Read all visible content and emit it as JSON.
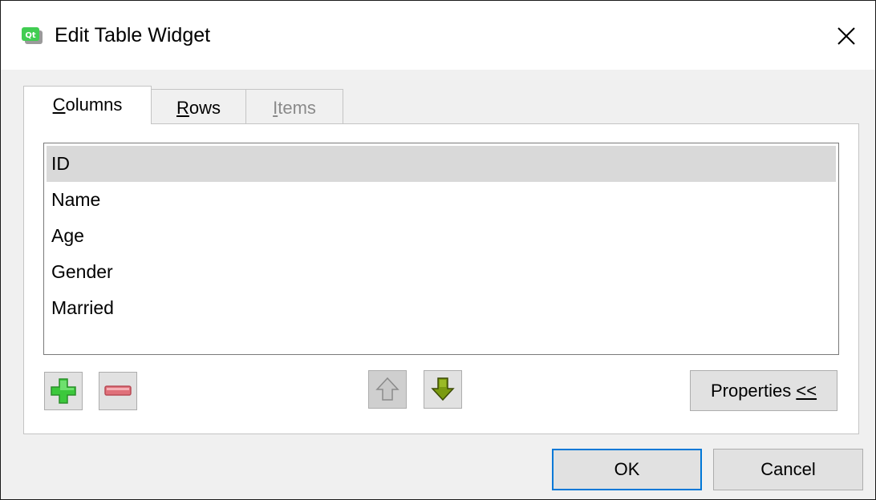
{
  "window": {
    "title": "Edit Table Widget",
    "app_icon": "qt-designer-icon",
    "close_icon": "close-icon"
  },
  "tabs": [
    {
      "mnemonic": "C",
      "rest": "olumns",
      "active": true,
      "enabled": true
    },
    {
      "mnemonic": "R",
      "rest": "ows",
      "active": false,
      "enabled": true
    },
    {
      "mnemonic": "I",
      "rest": "tems",
      "active": false,
      "enabled": false
    }
  ],
  "columns_list": {
    "items": [
      "ID",
      "Name",
      "Age",
      "Gender",
      "Married"
    ],
    "selected_index": 0
  },
  "toolbar": {
    "add_icon": "plus-icon",
    "remove_icon": "minus-icon",
    "move_up_icon": "arrow-up-icon",
    "move_down_icon": "arrow-down-icon",
    "properties_label": "Properties ",
    "properties_suffix": "<<"
  },
  "buttons": {
    "ok": "OK",
    "cancel": "Cancel"
  },
  "colors": {
    "add": "#3cc83c",
    "remove": "#e0707a",
    "move_down": "#7a9a10",
    "focus_border": "#0078d7"
  }
}
